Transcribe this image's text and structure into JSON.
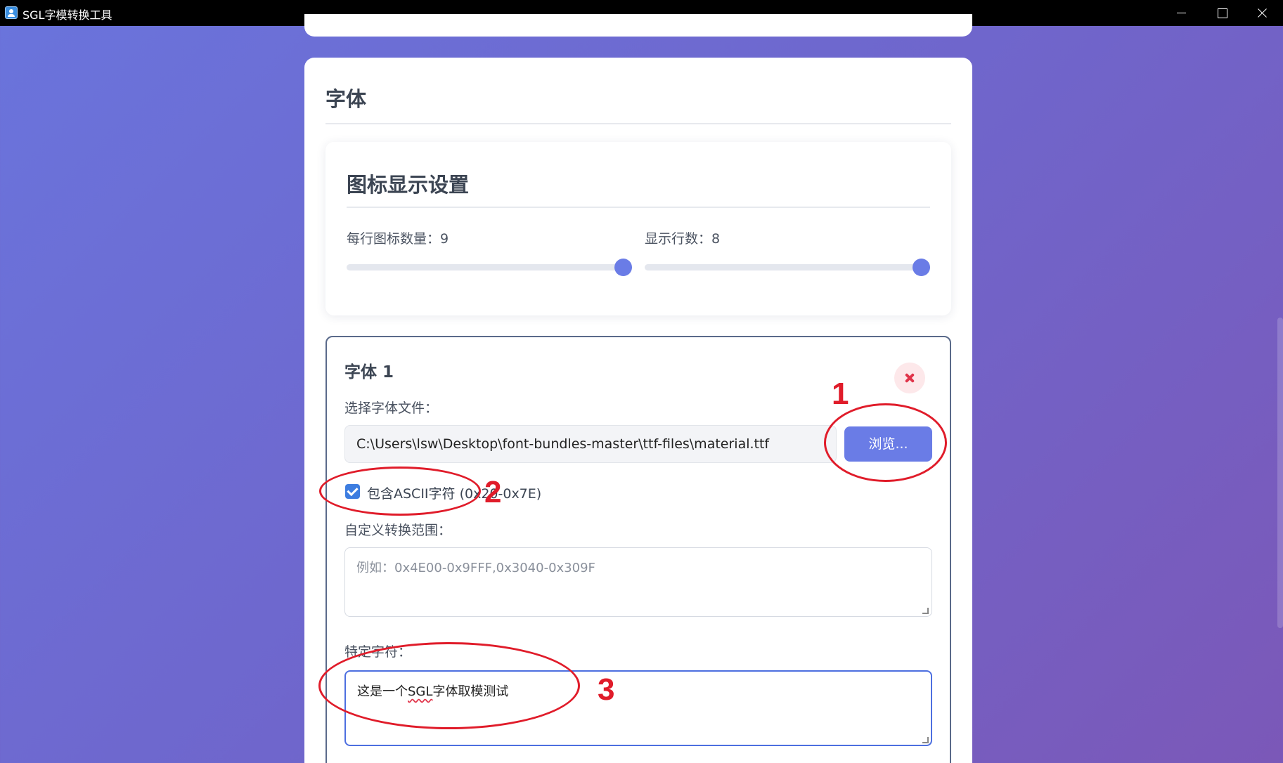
{
  "window": {
    "title": "SGL字模转换工具"
  },
  "section": {
    "title": "字体"
  },
  "display_settings": {
    "title": "图标显示设置",
    "icons_per_row_label": "每行图标数量：9",
    "icons_per_row": 9,
    "rows_label": "显示行数：8",
    "rows": 8
  },
  "font_entry": {
    "title": "字体 1",
    "file_label": "选择字体文件：",
    "file_path": "C:\\Users\\lsw\\Desktop\\font-bundles-master\\ttf-files\\material.ttf",
    "browse_label": "浏览...",
    "ascii_checked": true,
    "ascii_label": "包含ASCII字符 (0x20-0x7E)",
    "range_label": "自定义转换范围：",
    "range_placeholder": "例如：0x4E00-0x9FFF,0x3040-0x309F",
    "specific_label": "特定字符：",
    "specific_prefix": "这是一个",
    "specific_flagged": "SGL",
    "specific_suffix": "字体取模测试"
  },
  "annotations": {
    "one": "1",
    "two": "2",
    "three": "3",
    "color": "#e01c2a"
  },
  "colors": {
    "accent": "#6a7ce6",
    "checkbox": "#3d7de0",
    "focus_border": "#4d6fe0"
  }
}
